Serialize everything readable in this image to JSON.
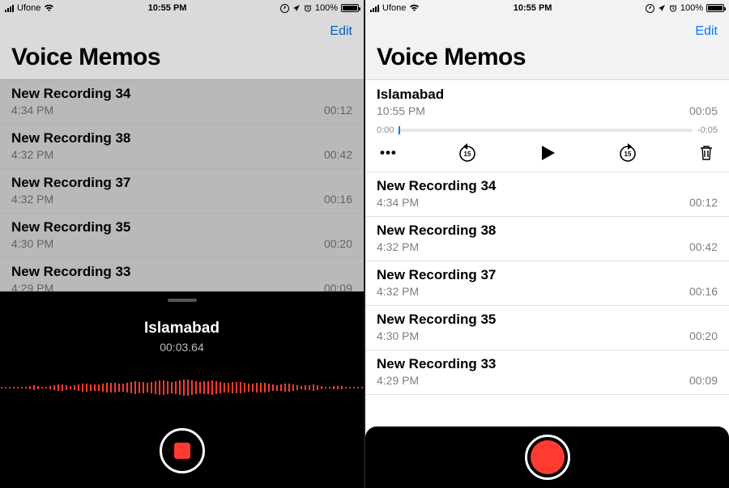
{
  "left": {
    "status": {
      "carrier": "Ufone",
      "time": "10:55 PM",
      "battery": "100%"
    },
    "edit": "Edit",
    "title": "Voice Memos",
    "recordings": [
      {
        "name": "New Recording 34",
        "time": "4:34 PM",
        "duration": "00:12"
      },
      {
        "name": "New Recording 38",
        "time": "4:32 PM",
        "duration": "00:42"
      },
      {
        "name": "New Recording 37",
        "time": "4:32 PM",
        "duration": "00:16"
      },
      {
        "name": "New Recording 35",
        "time": "4:30 PM",
        "duration": "00:20"
      },
      {
        "name": "New Recording 33",
        "time": "4:29 PM",
        "duration": "00:09"
      }
    ],
    "sheet": {
      "name": "Islamabad",
      "elapsed": "00:03.64"
    }
  },
  "right": {
    "status": {
      "carrier": "Ufone",
      "time": "10:55 PM",
      "battery": "100%"
    },
    "edit": "Edit",
    "title": "Voice Memos",
    "selected": {
      "name": "Islamabad",
      "time": "10:55 PM",
      "duration": "00:05",
      "pos": "0:00",
      "remain": "-0:05"
    },
    "recordings": [
      {
        "name": "New Recording 34",
        "time": "4:34 PM",
        "duration": "00:12"
      },
      {
        "name": "New Recording 38",
        "time": "4:32 PM",
        "duration": "00:42"
      },
      {
        "name": "New Recording 37",
        "time": "4:32 PM",
        "duration": "00:16"
      },
      {
        "name": "New Recording 35",
        "time": "4:30 PM",
        "duration": "00:20"
      },
      {
        "name": "New Recording 33",
        "time": "4:29 PM",
        "duration": "00:09"
      }
    ]
  }
}
